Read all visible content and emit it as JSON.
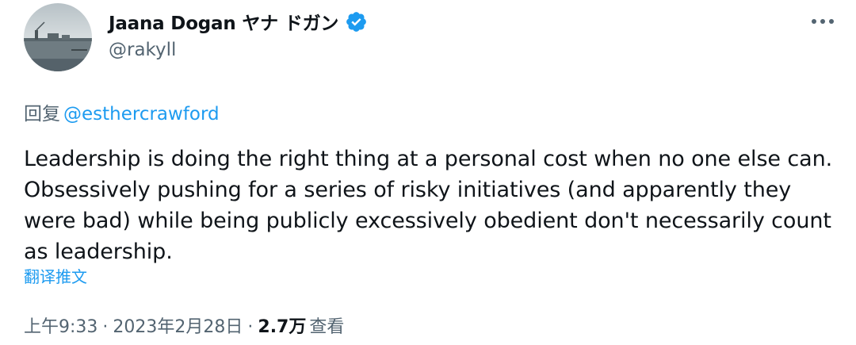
{
  "author": {
    "display_name": "Jaana Dogan ヤナ ドガン",
    "handle": "@rakyll"
  },
  "reply": {
    "prefix": "回复",
    "mention": "@esthercrawford"
  },
  "tweet": {
    "text": "Leadership is doing the right thing at a personal cost when no one else can. Obsessively pushing for a series of risky initiatives (and apparently they were bad) while being publicly excessively obedient don't necessarily count as leadership.",
    "translate_label": "翻译推文"
  },
  "meta": {
    "time": "上午9:33",
    "separator": "·",
    "date": "2023年2月28日",
    "views_count": "2.7万",
    "views_label": "查看"
  },
  "icons": {
    "verified": "verified-badge-icon",
    "more": "more-options-icon"
  },
  "colors": {
    "accent": "#1d9bf0",
    "text_primary": "#0f1419",
    "text_secondary": "#536471"
  }
}
